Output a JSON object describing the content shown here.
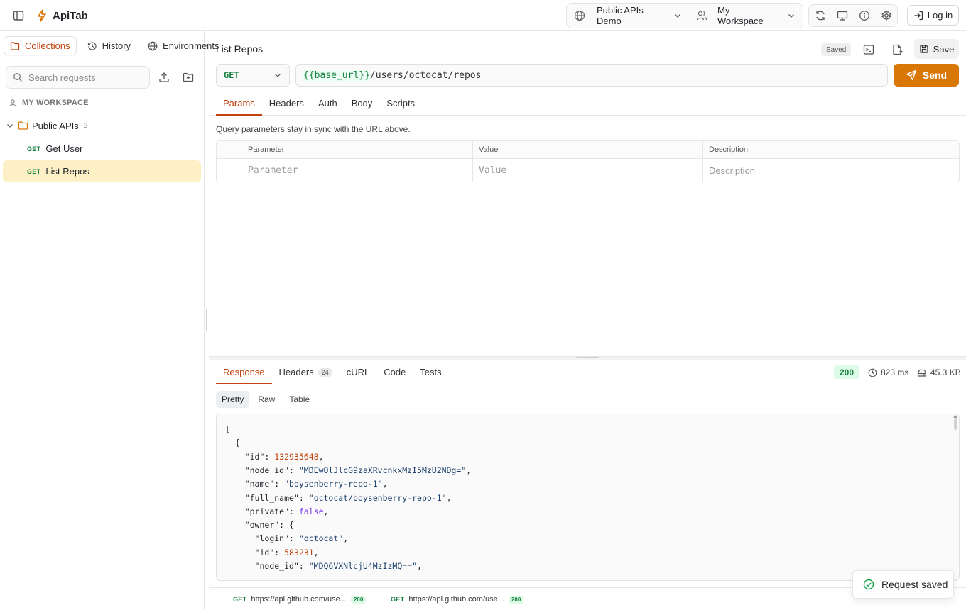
{
  "app": {
    "name": "ApiTab"
  },
  "header": {
    "project": "Public APIs Demo",
    "workspace": "My Workspace",
    "login_label": "Log in",
    "icons": [
      "sidebar-toggle-icon",
      "bolt-icon",
      "globe-icon",
      "users-icon",
      "refresh-icon",
      "monitor-icon",
      "info-icon",
      "gear-icon",
      "login-icon"
    ]
  },
  "sidebar": {
    "tabs": [
      {
        "label": "Collections",
        "icon": "folder-icon",
        "active": true
      },
      {
        "label": "History",
        "icon": "history-icon"
      },
      {
        "label": "Environments",
        "icon": "globe-icon"
      }
    ],
    "search_placeholder": "Search requests",
    "workspace_label": "MY WORKSPACE",
    "folder": {
      "name": "Public APIs",
      "count": "2"
    },
    "requests": [
      {
        "method": "GET",
        "name": "Get User",
        "active": false
      },
      {
        "method": "GET",
        "name": "List Repos",
        "active": true
      }
    ]
  },
  "request": {
    "title": "List Repos",
    "saved_badge": "Saved",
    "save_label": "Save",
    "method": "GET",
    "url_var": "{{base_url}}",
    "url_path": "/users/octocat/repos",
    "send_label": "Send",
    "tabs": [
      "Params",
      "Headers",
      "Auth",
      "Body",
      "Scripts"
    ],
    "active_tab": "Params",
    "params_hint": "Query parameters stay in sync with the URL above.",
    "params_columns": [
      "Parameter",
      "Value",
      "Description"
    ],
    "params_placeholders": [
      "Parameter",
      "Value",
      "Description"
    ]
  },
  "response": {
    "tabs": [
      {
        "label": "Response",
        "active": true
      },
      {
        "label": "Headers",
        "count": "24"
      },
      {
        "label": "cURL"
      },
      {
        "label": "Code"
      },
      {
        "label": "Tests"
      }
    ],
    "status": "200",
    "time": "823 ms",
    "size": "45.3 KB",
    "views": [
      "Pretty",
      "Raw",
      "Table"
    ],
    "active_view": "Pretty",
    "body_lines": [
      "[",
      "  {",
      "    \"id\": 132935648,",
      "    \"node_id\": \"MDEwOlJlcG9zaXRvcnkxMzI5MzU2NDg=\",",
      "    \"name\": \"boysenberry-repo-1\",",
      "    \"full_name\": \"octocat/boysenberry-repo-1\",",
      "    \"private\": false,",
      "    \"owner\": {",
      "      \"login\": \"octocat\",",
      "      \"id\": 583231,",
      "      \"node_id\": \"MDQ6VXNlcjU4MzIzMQ==\","
    ]
  },
  "history": [
    {
      "method": "GET",
      "url": "https://api.github.com/use...",
      "status": "200"
    },
    {
      "method": "GET",
      "url": "https://api.github.com/use...",
      "status": "200"
    }
  ],
  "toast": {
    "message": "Request saved"
  },
  "colors": {
    "accent": "#d97706",
    "accent_text": "#c2410c",
    "get_method": "#15803d",
    "active_item_bg": "#fdf0c6"
  }
}
